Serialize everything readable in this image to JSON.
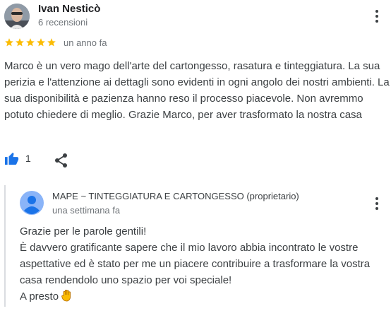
{
  "review": {
    "reviewer_name": "Ivan Nesticò",
    "reviewer_meta": "6 recensioni",
    "rating": 5,
    "date": "un anno fa",
    "text": "Marco è un vero mago dell'arte del cartongesso, rasatura e tinteggiatura. La sua perizia e l'attenzione ai dettagli sono evidenti in ogni angolo dei nostri ambienti. La sua disponibilità e pazienza hanno reso il processo piacevole. Non avremmo potuto chiedere di meglio. Grazie Marco, per aver trasformato la nostra casa",
    "like_count": "1"
  },
  "reply": {
    "owner_name": "MAPE ~ TINTEGGIATURA E CARTONGESSO (proprietario)",
    "date": "una settimana fa",
    "lines": [
      "Grazie per le parole gentili!",
      "È davvero gratificante sapere che il mio lavoro abbia incontrato le vostre",
      "aspettative ed è stato per me un piacere contribuire a trasformare la vostra",
      "casa rendendolo uno spazio per voi speciale!",
      "A presto"
    ]
  },
  "icons": {
    "star": "star-icon",
    "like": "thumbs-up-icon",
    "share": "share-icon",
    "menu": "more-vert-icon",
    "wave": "waving-hand-emoji"
  },
  "colors": {
    "star": "#fbbc04",
    "like": "#1a73e8",
    "owner_avatar": "#8ab4f8",
    "divider": "#dadce0"
  }
}
